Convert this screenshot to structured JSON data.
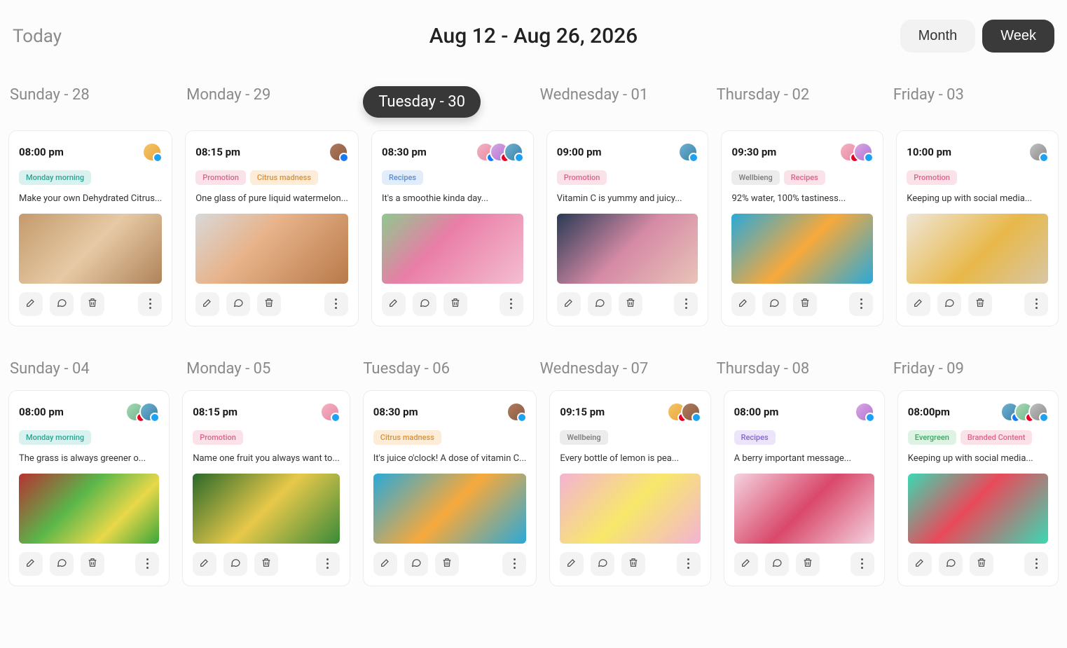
{
  "header": {
    "today_label": "Today",
    "date_range": "Aug 12 - Aug 26, 2026",
    "view_month": "Month",
    "view_week": "Week"
  },
  "weeks": [
    {
      "days": [
        {
          "label": "Sunday - 28",
          "active": false
        },
        {
          "label": "Monday - 29",
          "active": false
        },
        {
          "label": "Tuesday - 30",
          "active": true
        },
        {
          "label": "Wednesday - 01",
          "active": false
        },
        {
          "label": "Thursday - 02",
          "active": false
        },
        {
          "label": "Friday - 03",
          "active": false
        }
      ],
      "cards": [
        {
          "time": "08:00 pm",
          "avatars": [
            {
              "c": "av1",
              "b": "b-tw"
            }
          ],
          "tags": [
            {
              "t": "Monday morning",
              "c": "tag-teal"
            }
          ],
          "text": "Make your own Dehydrated Citrus...",
          "img": "img0"
        },
        {
          "time": "08:15 pm",
          "avatars": [
            {
              "c": "av2",
              "b": "b-fb"
            }
          ],
          "tags": [
            {
              "t": "Promotion",
              "c": "tag-pink"
            },
            {
              "t": "Citrus madness",
              "c": "tag-orange"
            }
          ],
          "text": "One glass of pure liquid watermelon...",
          "img": "img1"
        },
        {
          "time": "08:30 pm",
          "avatars": [
            {
              "c": "av3",
              "b": "b-fb"
            },
            {
              "c": "av5",
              "b": "b-pn"
            },
            {
              "c": "av4",
              "b": "b-tw"
            }
          ],
          "tags": [
            {
              "t": "Recipes",
              "c": "tag-blue"
            }
          ],
          "text": "It's a smoothie kinda day...",
          "img": "img2"
        },
        {
          "time": "09:00 pm",
          "avatars": [
            {
              "c": "av4",
              "b": "b-tw"
            }
          ],
          "tags": [
            {
              "t": "Promotion",
              "c": "tag-pink"
            }
          ],
          "text": "Vitamin C is yummy and juicy...",
          "img": "img3"
        },
        {
          "time": "09:30 pm",
          "avatars": [
            {
              "c": "av3",
              "b": "b-pn"
            },
            {
              "c": "av5",
              "b": "b-tw"
            }
          ],
          "tags": [
            {
              "t": "Wellbieng",
              "c": "tag-grey"
            },
            {
              "t": "Recipes",
              "c": "tag-pink"
            }
          ],
          "text": "92% water, 100% tastiness...",
          "img": "img4"
        },
        {
          "time": "10:00 pm",
          "avatars": [
            {
              "c": "av7",
              "b": "b-tw"
            }
          ],
          "tags": [
            {
              "t": "Promotion",
              "c": "tag-pink"
            }
          ],
          "text": "Keeping up with social media...",
          "img": "img5"
        }
      ]
    },
    {
      "days": [
        {
          "label": "Sunday - 04",
          "active": false
        },
        {
          "label": "Monday - 05",
          "active": false
        },
        {
          "label": "Tuesday - 06",
          "active": false
        },
        {
          "label": "Wednesday - 07",
          "active": false
        },
        {
          "label": "Thursday - 08",
          "active": false
        },
        {
          "label": "Friday - 09",
          "active": false
        }
      ],
      "cards": [
        {
          "time": "08:00 pm",
          "avatars": [
            {
              "c": "av6",
              "b": "b-pn"
            },
            {
              "c": "av4",
              "b": "b-tw"
            }
          ],
          "tags": [
            {
              "t": "Monday morning",
              "c": "tag-teal"
            }
          ],
          "text": "The grass is always greener o...",
          "img": "img6"
        },
        {
          "time": "08:15 pm",
          "avatars": [
            {
              "c": "av3",
              "b": "b-tw"
            }
          ],
          "tags": [
            {
              "t": "Promotion",
              "c": "tag-pink"
            }
          ],
          "text": "Name one fruit you always want to...",
          "img": "img7"
        },
        {
          "time": "08:30 pm",
          "avatars": [
            {
              "c": "av2",
              "b": "b-tw"
            }
          ],
          "tags": [
            {
              "t": "Citrus madness",
              "c": "tag-orange"
            }
          ],
          "text": "It's juice o'clock! A dose of vitamin C...",
          "img": "img8"
        },
        {
          "time": "09:15 pm",
          "avatars": [
            {
              "c": "av1",
              "b": "b-pn"
            },
            {
              "c": "av2",
              "b": "b-tw"
            }
          ],
          "tags": [
            {
              "t": "Wellbeing",
              "c": "tag-grey"
            }
          ],
          "text": "Every bottle of lemon is pea...",
          "img": "img9"
        },
        {
          "time": "08:00 pm",
          "avatars": [
            {
              "c": "av5",
              "b": "b-tw"
            }
          ],
          "tags": [
            {
              "t": "Recipes",
              "c": "tag-purple"
            }
          ],
          "text": "A berry important message...",
          "img": "img10"
        },
        {
          "time": "08:00pm",
          "avatars": [
            {
              "c": "av4",
              "b": "b-fb"
            },
            {
              "c": "av6",
              "b": "b-pn"
            },
            {
              "c": "av7",
              "b": "b-tw"
            }
          ],
          "tags": [
            {
              "t": "Evergreen",
              "c": "tag-green"
            },
            {
              "t": "Branded Content",
              "c": "tag-pink"
            }
          ],
          "text": "Keeping up with social media...",
          "img": "img11"
        }
      ]
    }
  ]
}
